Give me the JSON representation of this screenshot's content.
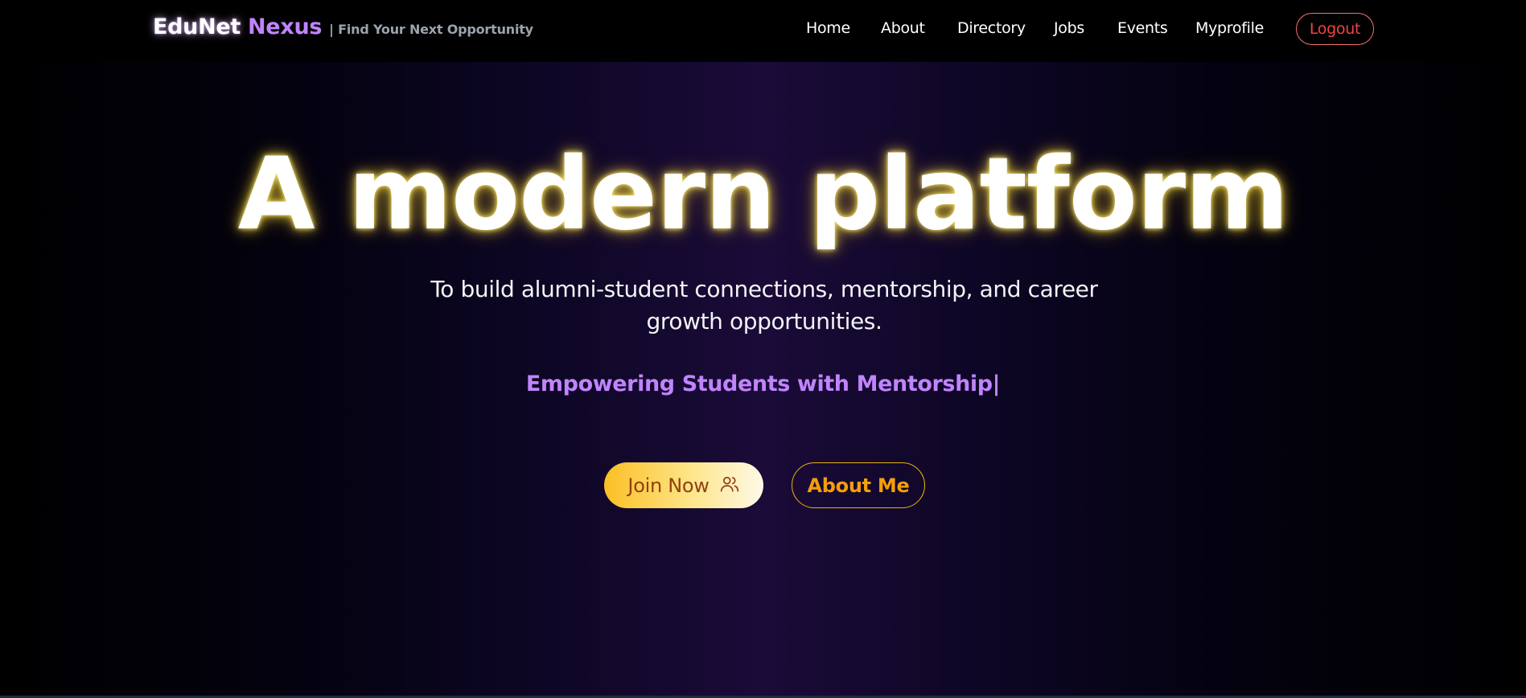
{
  "brand": {
    "name": "EduNet",
    "accent": "Nexus",
    "tagline": "| Find Your Next Opportunity"
  },
  "nav": {
    "items": [
      {
        "label": "Home"
      },
      {
        "label": "About"
      },
      {
        "label": "Directory"
      },
      {
        "label": "Jobs"
      },
      {
        "label": "Events"
      },
      {
        "label": "Myprofile"
      }
    ],
    "logout_label": "Logout"
  },
  "hero": {
    "headline": "A modern platform",
    "subtitle": "To build alumni-student connections, mentorship, and career growth opportunities.",
    "typing_text": "Empowering Students with Mentorship|",
    "join_label": "Join Now",
    "join_icon": "users-icon",
    "about_label": "About Me"
  },
  "colors": {
    "brand_accent": "#c084fc",
    "logout": "#ef4444",
    "typing": "#c084fc",
    "join_text": "#92400e",
    "about_text": "#f59e0b",
    "headline_glow": "#fde047"
  }
}
